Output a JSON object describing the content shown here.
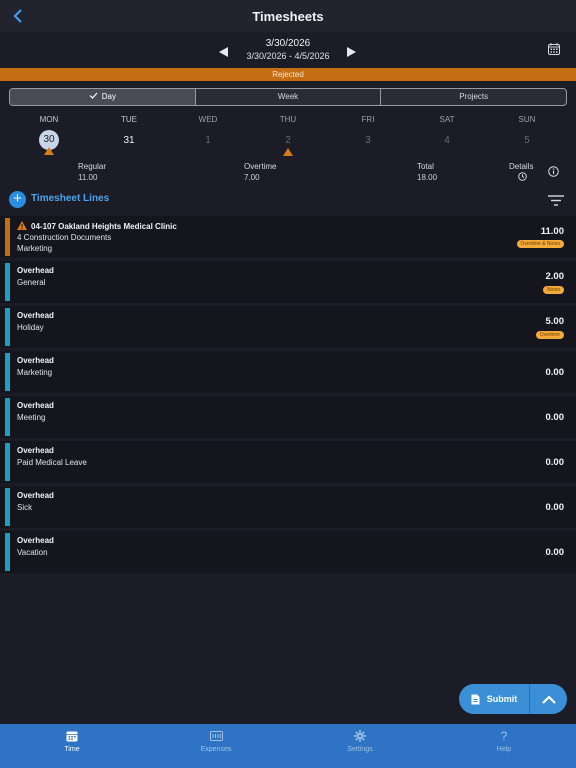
{
  "header": {
    "title": "Timesheets"
  },
  "dates": {
    "current": "3/30/2026",
    "range": "3/30/2026 - 4/5/2026"
  },
  "status": "Rejected",
  "segments": [
    "Day",
    "Week",
    "Projects"
  ],
  "days": [
    {
      "name": "MON",
      "num": "30",
      "selected": true,
      "flag": true
    },
    {
      "name": "TUE",
      "num": "31",
      "selected": false,
      "flag": false
    },
    {
      "name": "WED",
      "num": "1",
      "selected": false,
      "flag": false
    },
    {
      "name": "THU",
      "num": "2",
      "selected": false,
      "flag": true
    },
    {
      "name": "FRI",
      "num": "3",
      "selected": false,
      "flag": false
    },
    {
      "name": "SAT",
      "num": "4",
      "selected": false,
      "flag": false
    },
    {
      "name": "SUN",
      "num": "5",
      "selected": false,
      "flag": false
    }
  ],
  "totals": {
    "regular_label": "Regular",
    "regular_value": "11.00",
    "overtime_label": "Overtime",
    "overtime_value": "7.00",
    "total_label": "Total",
    "total_value": "18.00",
    "details_label": "Details"
  },
  "lines_title": "Timesheet Lines",
  "lines": [
    {
      "title": "04-107 Oakland Heights Medical Clinic",
      "sub1": "4 Construction Documents",
      "sub2": "Marketing",
      "hours": "11.00",
      "badge": "Overtime & Notes",
      "warning": true,
      "color": "#c46d12"
    },
    {
      "title": "Overhead",
      "sub1": "General",
      "sub2": "",
      "hours": "2.00",
      "badge": "Notes",
      "warning": false,
      "color": "#1f9ec4"
    },
    {
      "title": "Overhead",
      "sub1": "Holiday",
      "sub2": "",
      "hours": "5.00",
      "badge": "Overtime",
      "warning": false,
      "color": "#1f9ec4"
    },
    {
      "title": "Overhead",
      "sub1": "Marketing",
      "sub2": "",
      "hours": "0.00",
      "badge": "",
      "warning": false,
      "color": "#1f9ec4"
    },
    {
      "title": "Overhead",
      "sub1": "Meeting",
      "sub2": "",
      "hours": "0.00",
      "badge": "",
      "warning": false,
      "color": "#1f9ec4"
    },
    {
      "title": "Overhead",
      "sub1": "Paid Medical Leave",
      "sub2": "",
      "hours": "0.00",
      "badge": "",
      "warning": false,
      "color": "#1f9ec4"
    },
    {
      "title": "Overhead",
      "sub1": "Sick",
      "sub2": "",
      "hours": "0.00",
      "badge": "",
      "warning": false,
      "color": "#1f9ec4"
    },
    {
      "title": "Overhead",
      "sub1": "Vacation",
      "sub2": "",
      "hours": "0.00",
      "badge": "",
      "warning": false,
      "color": "#1f9ec4"
    }
  ],
  "fab": {
    "submit_label": "Submit"
  },
  "tabs": [
    {
      "label": "Time",
      "icon": "calendar-icon",
      "active": true
    },
    {
      "label": "Expenses",
      "icon": "receipt-icon",
      "active": false
    },
    {
      "label": "Settings",
      "icon": "gear-icon",
      "active": false
    },
    {
      "label": "Help",
      "icon": "question-icon",
      "active": false
    }
  ]
}
